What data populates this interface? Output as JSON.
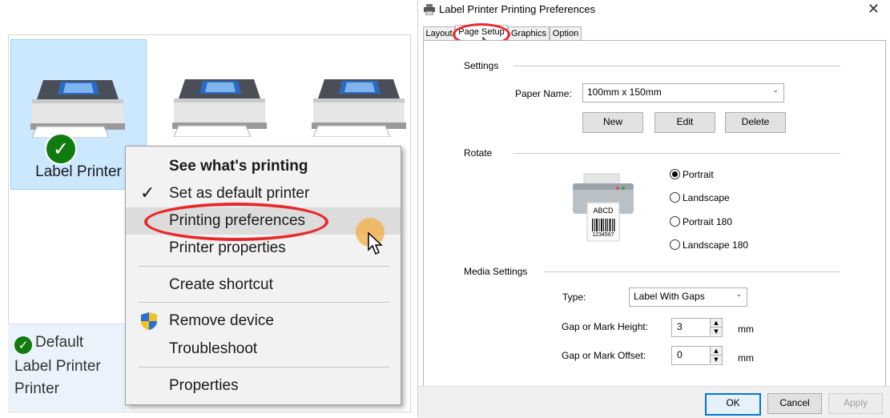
{
  "devices": {
    "printers": [
      {
        "label": "Label Printer",
        "selected": true,
        "default": true
      },
      {
        "label": "",
        "selected": false,
        "default": false
      },
      {
        "label": "",
        "selected": false,
        "default": false
      }
    ],
    "details": {
      "line1": "Default",
      "line2": "Label Printer",
      "line3": "Printer"
    },
    "check_icon": "✓"
  },
  "context_menu": {
    "items": [
      {
        "label": "See what's printing"
      },
      {
        "label": "Set as default printer"
      },
      {
        "label": "Printing preferences"
      },
      {
        "label": "Printer properties"
      },
      {
        "label": "Create shortcut"
      },
      {
        "label": "Remove device"
      },
      {
        "label": "Troubleshoot"
      },
      {
        "label": "Properties"
      }
    ],
    "check_icon": "✓",
    "shield_icon": "shield-icon"
  },
  "dialog": {
    "title": "Label Printer Printing Preferences",
    "close_icon": "✕",
    "tabs": [
      {
        "label": "Layout"
      },
      {
        "label": "Page Setup"
      },
      {
        "label": "Graphics"
      },
      {
        "label": "Option"
      }
    ],
    "settings": {
      "title": "Settings",
      "paper_name_label": "Paper Name:",
      "paper_name_value": "100mm x 150mm",
      "new_label": "New",
      "edit_label": "Edit",
      "delete_label": "Delete"
    },
    "rotate": {
      "title": "Rotate",
      "label_text": "ABCD",
      "barcode_number": "1234567",
      "options": [
        {
          "label": "Portrait",
          "checked": true
        },
        {
          "label": "Landscape",
          "checked": false
        },
        {
          "label": "Portrait 180",
          "checked": false
        },
        {
          "label": "Landscape 180",
          "checked": false
        }
      ]
    },
    "media": {
      "title": "Media Settings",
      "type_label": "Type:",
      "type_value": "Label With Gaps",
      "gap_height_label": "Gap or Mark Height:",
      "gap_height_value": "3",
      "gap_offset_label": "Gap or Mark Offset:",
      "gap_offset_value": "0",
      "unit": "mm"
    },
    "buttons": {
      "ok": "OK",
      "cancel": "Cancel",
      "apply": "Apply"
    },
    "dropdown_icon": "⌄",
    "spin_up_icon": "▲",
    "spin_down_icon": "▼"
  },
  "colors": {
    "highlight_oval": "#e8292c",
    "selection": "#cce8ff",
    "default_check": "#107c10"
  }
}
